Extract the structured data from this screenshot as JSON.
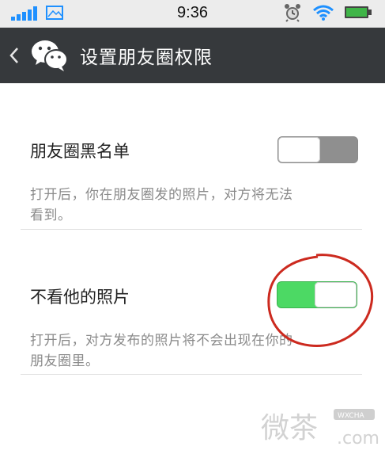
{
  "status_bar": {
    "time": "9:36"
  },
  "header": {
    "title": "设置朋友圈权限"
  },
  "settings": [
    {
      "label": "朋友圈黑名单",
      "description_lines": [
        "打开后，你在朋友圈发的照片，对方将无法",
        "看到。"
      ],
      "enabled": false
    },
    {
      "label": "不看他的照片",
      "description_lines": [
        "打开后，对方发布的照片将不会出现在你的",
        "朋友圈里。"
      ],
      "enabled": true
    }
  ],
  "watermark": {
    "text": "微茶",
    "tag": "WXCHA",
    "domain": ".com"
  },
  "colors": {
    "header_bg": "#36393c",
    "toggle_on": "#4cd964",
    "toggle_off": "#8f8f8f",
    "annotation": "#cc2a1f"
  }
}
